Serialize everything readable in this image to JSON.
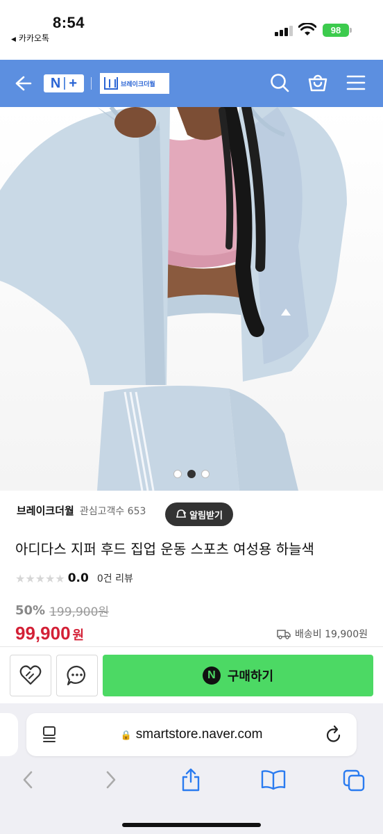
{
  "status_bar": {
    "time": "8:54",
    "back_app": "카카오톡",
    "battery": "98"
  },
  "header": {
    "nplus_left": "N",
    "nplus_right": "+",
    "store_logo_text": "브레이크더월"
  },
  "product": {
    "image_dots": 3,
    "active_dot": 1,
    "store_name": "브레이크더월",
    "fav_label": "관심고객수 653",
    "alarm_label": "알림받기",
    "title": "아디다스 지퍼 후드 집업 운동 스포츠 여성용 하늘색",
    "stars": "★★★★★",
    "rating": "0.0",
    "reviews": "0건 리뷰",
    "discount": "50%",
    "original_price": "199,900원",
    "price": "99,900",
    "price_unit": "원",
    "shipping": "배송비 19,900원"
  },
  "actions": {
    "buy_label": "구매하기",
    "buy_badge": "N"
  },
  "browser": {
    "url": "smartstore.naver.com",
    "lock": "🔒"
  },
  "colors": {
    "header": "#5c8fe0",
    "buy": "#4cd964",
    "price": "#d32036",
    "jacket": "#c9d9e6",
    "top": "#e2a5b8"
  }
}
